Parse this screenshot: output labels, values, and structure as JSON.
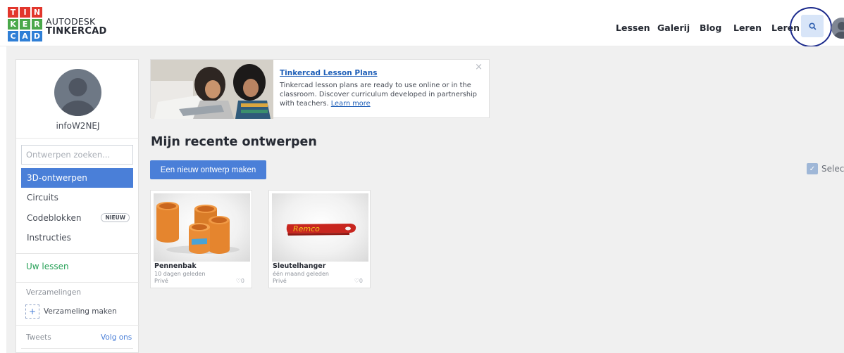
{
  "header": {
    "logo_letters": [
      "T",
      "I",
      "N",
      "K",
      "E",
      "R",
      "C",
      "A",
      "D"
    ],
    "brand_top": "AUTODESK",
    "brand_bottom": "TINKERCAD",
    "nav": [
      "Lessen",
      "Galerij",
      "Blog",
      "Leren",
      "Leren"
    ],
    "colors": {
      "logo_red": "#e2362c",
      "logo_green": "#4aa84a",
      "logo_blue": "#2f7fd6",
      "logo_orange": "#f08c1d"
    }
  },
  "sidebar": {
    "username": "infoW2NEJ",
    "search_placeholder": "Ontwerpen zoeken...",
    "items": [
      {
        "label": "3D-ontwerpen",
        "active": true
      },
      {
        "label": "Circuits"
      },
      {
        "label": "Codeblokken",
        "badge": "NIEUW"
      },
      {
        "label": "Instructies"
      }
    ],
    "lessons": "Uw lessen",
    "collections_label": "Verzamelingen",
    "make_collection": "Verzameling maken",
    "tweets": "Tweets",
    "follow": "Volg ons"
  },
  "banner": {
    "title": "Tinkercad Lesson Plans",
    "text": "Tinkercad lesson plans are ready to use online or in the classroom. Discover curriculum developed in partnership with teachers.",
    "link": "Learn more",
    "close": "×"
  },
  "main": {
    "title": "Mijn recente ontwerpen",
    "new_button": "Een nieuw ontwerp maken",
    "select_all": "Select"
  },
  "designs": [
    {
      "name": "Pennenbak",
      "date": "10 dagen geleden",
      "privacy": "Privé",
      "likes": "0"
    },
    {
      "name": "Sleutelhanger",
      "date": "één maand geleden",
      "privacy": "Privé",
      "likes": "0",
      "text_on_model": "Remco"
    }
  ]
}
